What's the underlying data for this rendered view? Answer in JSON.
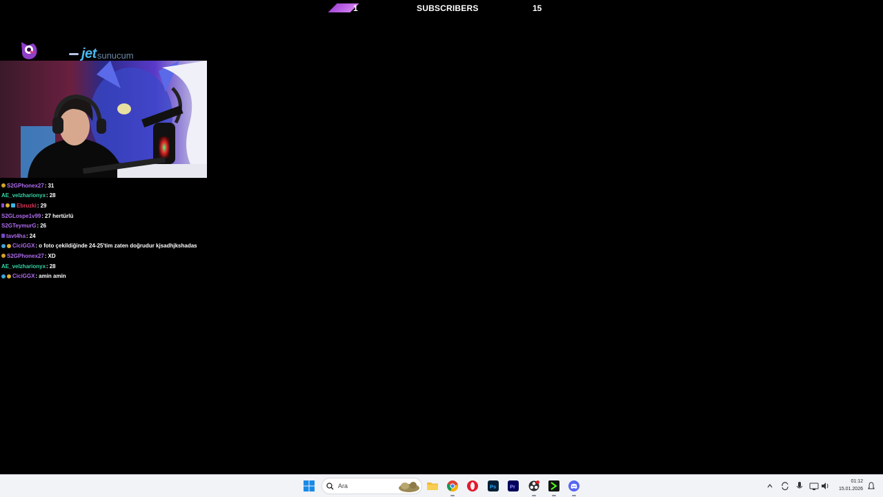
{
  "top_bar": {
    "left_count": "1",
    "title": "SUBSCRIBERS",
    "right_count": "15"
  },
  "logos": {
    "brand": "jet",
    "brand_suffix": "sunucum"
  },
  "chat": [
    {
      "user": "S2GPhonex27",
      "color": "#b06cf0",
      "badges": [
        "#d4a32b"
      ],
      "message": "31"
    },
    {
      "user": "AE_velzharionyx",
      "color": "#36d6a8",
      "badges": [],
      "message": "28"
    },
    {
      "user": "Ebruzki",
      "color": "#e0345a",
      "badges": [
        "#8a4fd8",
        "#d8b130",
        "#3ab6e0"
      ],
      "message": "29"
    },
    {
      "user": "S2GLospe1v99",
      "color": "#b06cf0",
      "badges": [],
      "message": "27 hertürlü"
    },
    {
      "user": "S2GTeymurG",
      "color": "#b06cf0",
      "badges": [],
      "message": "26"
    },
    {
      "user": "tavt4ha",
      "color": "#b06cf0",
      "badges": [
        "#7a48c8"
      ],
      "message": "24"
    },
    {
      "user": "CiciGGX",
      "color": "#b06cf0",
      "badges": [
        "#3aa6d8",
        "#d8b130"
      ],
      "message": "o foto çekildiğinde 24-25'tim zaten doğrudur kjsadhjkshadas"
    },
    {
      "user": "S2GPhonex27",
      "color": "#b06cf0",
      "badges": [
        "#d4a32b"
      ],
      "message": "XD"
    },
    {
      "user": "AE_velzharionyx",
      "color": "#36d6a8",
      "badges": [],
      "message": "28"
    },
    {
      "user": "CiciGGX",
      "color": "#b06cf0",
      "badges": [
        "#3aa6d8",
        "#d8b130"
      ],
      "message": "amin amin"
    }
  ],
  "taskbar": {
    "search_placeholder": "Ara",
    "apps": [
      "start-icon",
      "search-icon",
      "widgets-icon",
      "file-explorer-icon",
      "chrome-icon",
      "opera-icon",
      "photoshop-icon",
      "premiere-icon",
      "obs-icon",
      "terminal-icon",
      "discord-icon"
    ],
    "time": "01:12",
    "date": "15.01.2026"
  }
}
